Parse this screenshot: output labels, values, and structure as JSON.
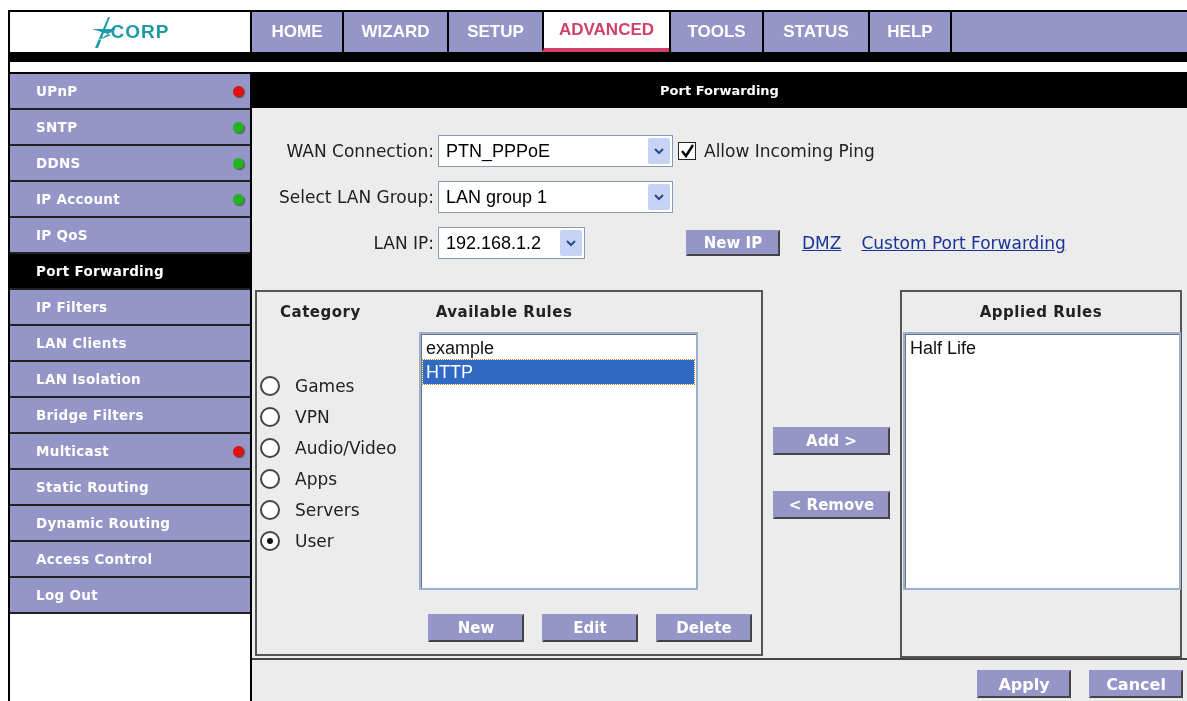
{
  "logo": {
    "text": "CORP"
  },
  "tabs": [
    {
      "label": "HOME",
      "selected": false
    },
    {
      "label": "WIZARD",
      "selected": false
    },
    {
      "label": "SETUP",
      "selected": false
    },
    {
      "label": "ADVANCED",
      "selected": true
    },
    {
      "label": "TOOLS",
      "selected": false
    },
    {
      "label": "STATUS",
      "selected": false
    },
    {
      "label": "HELP",
      "selected": false
    }
  ],
  "sidebar": {
    "items": [
      {
        "label": "UPnP",
        "selected": false,
        "color": "#e01010"
      },
      {
        "label": "SNTP",
        "selected": false,
        "color": "#22b322"
      },
      {
        "label": "DDNS",
        "selected": false,
        "color": "#22b322"
      },
      {
        "label": "IP Account",
        "selected": false,
        "color": "#22b322"
      },
      {
        "label": "IP QoS",
        "selected": false
      },
      {
        "label": "Port Forwarding",
        "selected": true
      },
      {
        "label": "IP Filters",
        "selected": false
      },
      {
        "label": "LAN Clients",
        "selected": false
      },
      {
        "label": "LAN Isolation",
        "selected": false
      },
      {
        "label": "Bridge Filters",
        "selected": false
      },
      {
        "label": "Multicast",
        "selected": false,
        "color": "#e01010"
      },
      {
        "label": "Static Routing",
        "selected": false
      },
      {
        "label": "Dynamic Routing",
        "selected": false
      },
      {
        "label": "Access Control",
        "selected": false
      },
      {
        "label": "Log Out",
        "selected": false
      }
    ]
  },
  "page_title": "Port Forwarding",
  "form": {
    "wan": {
      "label": "WAN Connection:",
      "value": "PTN_PPPoE"
    },
    "allow_ping": {
      "label": "Allow Incoming Ping",
      "checked": true
    },
    "lan_group": {
      "label": "Select LAN Group:",
      "value": "LAN group 1"
    },
    "lan_ip": {
      "label": "LAN IP:",
      "value": "192.168.1.2"
    },
    "new_ip_button": "New IP",
    "links": [
      "DMZ",
      "Custom Port Forwarding"
    ]
  },
  "category": {
    "title": "Category",
    "options": [
      {
        "label": "Games",
        "selected": false
      },
      {
        "label": "VPN",
        "selected": false
      },
      {
        "label": "Audio/Video",
        "selected": false
      },
      {
        "label": "Apps",
        "selected": false
      },
      {
        "label": "Servers",
        "selected": false
      },
      {
        "label": "User",
        "selected": true
      }
    ]
  },
  "available": {
    "title": "Available Rules",
    "items": [
      {
        "label": "example",
        "selected": false
      },
      {
        "label": "HTTP",
        "selected": true
      }
    ],
    "buttons": [
      "New",
      "Edit",
      "Delete"
    ]
  },
  "transfer_buttons": [
    "Add >",
    "< Remove"
  ],
  "applied": {
    "title": "Applied Rules",
    "items": [
      {
        "label": "Half Life",
        "selected": false
      }
    ]
  },
  "footer_buttons": [
    "Apply",
    "Cancel"
  ]
}
